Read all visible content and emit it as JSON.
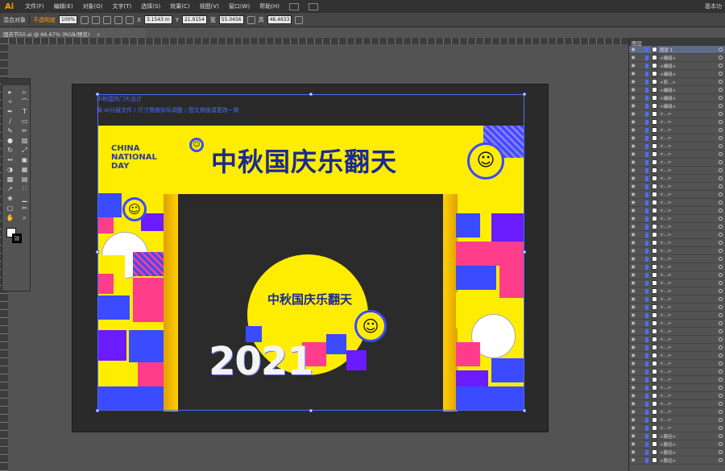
{
  "app": {
    "logo": "Ai",
    "workspace": "基本功"
  },
  "menu": [
    "文件(F)",
    "编辑(E)",
    "对象(O)",
    "文字(T)",
    "选择(S)",
    "效果(C)",
    "视图(V)",
    "窗口(W)",
    "帮助(H)"
  ],
  "controls": {
    "label": "混合对象",
    "opacity_label": "不透明度",
    "opacity_value": "100%",
    "x_value": "3.1543 m",
    "y_value": "21.9154",
    "w_value": "55.0456",
    "h_value": "48.4633"
  },
  "doc_tab": {
    "title": "国庆节50.ai @ 66.67% (RGB/预览)",
    "close": "×"
  },
  "artboard": {
    "note1": "中秋国庆门头设计",
    "note2": "源 AI分层文件 / 尺寸需按实际调整 / 图文排版请更改一致",
    "title": "中秋国庆乐翻天",
    "badge_line1": "CHINA",
    "badge_line2": "NATIONAL",
    "badge_line3": "DAY",
    "circle_title": "中秋国庆乐翻天",
    "year": "2021"
  },
  "layers_panel": {
    "title": "图层",
    "rows": [
      {
        "name": "图层 1",
        "selected": true
      },
      {
        "name": "<编组>"
      },
      {
        "name": "<编组>"
      },
      {
        "name": "<编组>"
      },
      {
        "name": "<剪...>"
      },
      {
        "name": "<编组>"
      },
      {
        "name": "<编组>"
      },
      {
        "name": "<编组>"
      },
      {
        "name": "<...>"
      },
      {
        "name": "<...>"
      },
      {
        "name": "<...>"
      },
      {
        "name": "<...>"
      },
      {
        "name": "<...>"
      },
      {
        "name": "<...>"
      },
      {
        "name": "<...>"
      },
      {
        "name": "<...>"
      },
      {
        "name": "<...>"
      },
      {
        "name": "<...>"
      },
      {
        "name": "<...>"
      },
      {
        "name": "<...>"
      },
      {
        "name": "<...>"
      },
      {
        "name": "<...>"
      },
      {
        "name": "<...>"
      },
      {
        "name": "<...>"
      },
      {
        "name": "<...>"
      },
      {
        "name": "<...>"
      },
      {
        "name": "<...>"
      },
      {
        "name": "<...>"
      },
      {
        "name": "<...>"
      },
      {
        "name": "<...>"
      },
      {
        "name": "<...>"
      },
      {
        "name": "<...>"
      },
      {
        "name": "<...>"
      },
      {
        "name": "<...>"
      },
      {
        "name": "<...>"
      },
      {
        "name": "<...>"
      },
      {
        "name": "<...>"
      },
      {
        "name": "<...>"
      },
      {
        "name": "<...>"
      },
      {
        "name": "<...>"
      },
      {
        "name": "<...>"
      },
      {
        "name": "<...>"
      },
      {
        "name": "<...>"
      },
      {
        "name": "<...>"
      },
      {
        "name": "<...>"
      },
      {
        "name": "<...>"
      },
      {
        "name": "<...>"
      },
      {
        "name": "<...>"
      },
      {
        "name": "<路径>"
      },
      {
        "name": "<路径>"
      },
      {
        "name": "<路径>"
      },
      {
        "name": "<路径>"
      }
    ]
  },
  "colors": {
    "yellow": "#ffed00",
    "blue": "#3b4bff",
    "pink": "#ff3d8b",
    "purple": "#6a1cff",
    "navy": "#1a2a90",
    "accent": "#ff9a00"
  }
}
